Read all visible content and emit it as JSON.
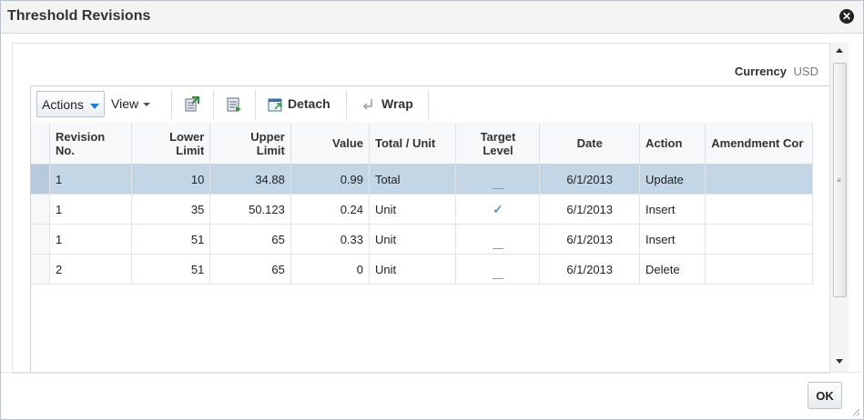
{
  "dialog": {
    "title": "Threshold Revisions",
    "close_glyph": "✕",
    "ok_label": "OK"
  },
  "currency": {
    "label": "Currency",
    "value": "USD"
  },
  "toolbar": {
    "actions_label": "Actions",
    "view_label": "View",
    "export_icon": "export-excel-icon",
    "column_icon": "manage-columns-icon",
    "detach_label": "Detach",
    "wrap_label": "Wrap"
  },
  "table": {
    "columns": [
      "Revision No.",
      "Lower Limit",
      "Upper Limit",
      "Value",
      "Total / Unit",
      "Target Level",
      "Date",
      "Action",
      "Amendment Comments"
    ],
    "col_lines": {
      "revision": [
        "Revision",
        "No."
      ],
      "lower": [
        "Lower",
        "Limit"
      ],
      "upper": [
        "Upper",
        "Limit"
      ],
      "value": "Value",
      "total_unit": "Total / Unit",
      "target": [
        "Target",
        "Level"
      ],
      "date": "Date",
      "action": "Action",
      "amendment": "Amendment Cor"
    },
    "rows": [
      {
        "revision": "1",
        "lower": "10",
        "upper": "34.88",
        "value": "0.99",
        "total_unit": "Total",
        "target": "dash",
        "date": "6/1/2013",
        "action": "Update",
        "amendment": ""
      },
      {
        "revision": "1",
        "lower": "35",
        "upper": "50.123",
        "value": "0.24",
        "total_unit": "Unit",
        "target": "check",
        "date": "6/1/2013",
        "action": "Insert",
        "amendment": ""
      },
      {
        "revision": "1",
        "lower": "51",
        "upper": "65",
        "value": "0.33",
        "total_unit": "Unit",
        "target": "dash",
        "date": "6/1/2013",
        "action": "Insert",
        "amendment": ""
      },
      {
        "revision": "2",
        "lower": "51",
        "upper": "65",
        "value": "0",
        "total_unit": "Unit",
        "target": "dash",
        "date": "6/1/2013",
        "action": "Delete",
        "amendment": ""
      }
    ]
  },
  "colors": {
    "selected_row": "#c2d6e6",
    "accent": "#1f7ad8"
  }
}
